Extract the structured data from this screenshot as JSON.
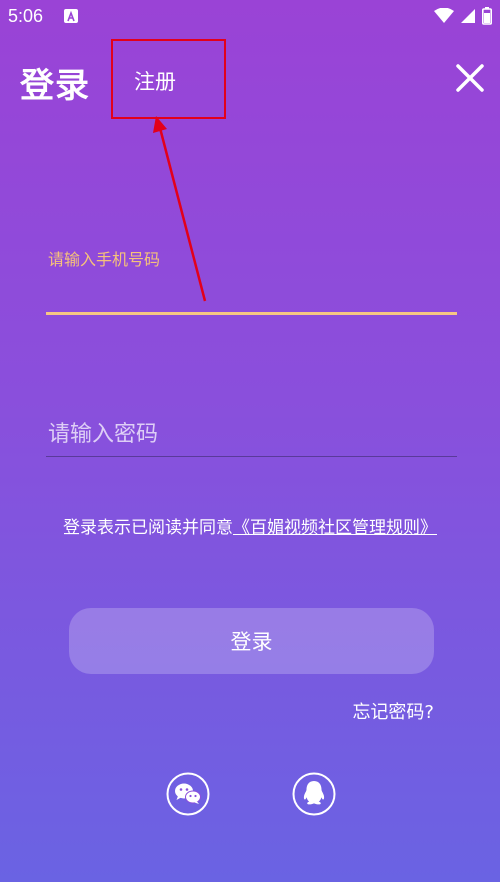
{
  "status_bar": {
    "time": "5:06",
    "icons": [
      "notification-a-icon",
      "wifi-icon",
      "cellular-signal-icon",
      "battery-icon"
    ]
  },
  "header": {
    "title": "登录",
    "register_label": "注册",
    "close_icon": "close-icon"
  },
  "form": {
    "phone_label": "请输入手机号码",
    "phone_value": "",
    "password_placeholder": "请输入密码",
    "password_value": ""
  },
  "agreement": {
    "prefix": "登录表示已阅读并同意",
    "link_text": "《百媚视频社区管理规则》"
  },
  "login_button_label": "登录",
  "forgot_password_label": "忘记密码?",
  "social_login": [
    "wechat-icon",
    "qq-icon"
  ],
  "colors": {
    "background_top": "#9a43d6",
    "background_bottom": "#6a63e3",
    "phone_label": "#f6c27a",
    "focus_underline": "#f7c684",
    "annotation": "#e3001b"
  }
}
